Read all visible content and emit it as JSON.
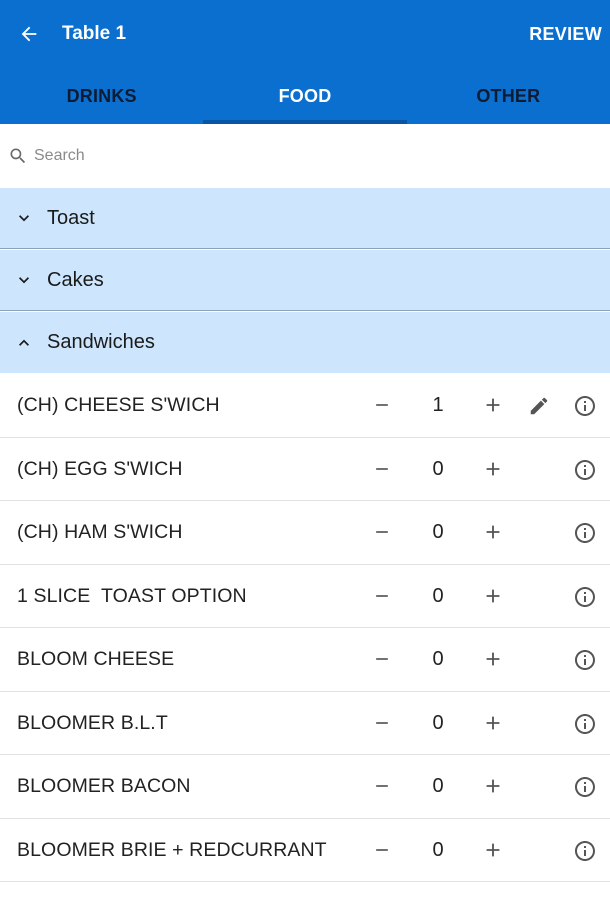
{
  "header": {
    "title": "Table 1",
    "review_label": "REVIEW",
    "back_icon": "arrow-left-icon",
    "background_color": "#0a6fcf"
  },
  "tabs": [
    {
      "label": "DRINKS",
      "active": false
    },
    {
      "label": "FOOD",
      "active": true
    },
    {
      "label": "OTHER",
      "active": false
    }
  ],
  "search": {
    "placeholder": "Search",
    "icon": "search-icon"
  },
  "categories": [
    {
      "label": "Toast",
      "expanded": false
    },
    {
      "label": "Cakes",
      "expanded": false
    },
    {
      "label": "Sandwiches",
      "expanded": true
    }
  ],
  "items": [
    {
      "name": "(CH) CHEESE S'WICH",
      "qty": "1",
      "editable": true
    },
    {
      "name": "(CH) EGG S'WICH",
      "qty": "0",
      "editable": false
    },
    {
      "name": "(CH) HAM S'WICH",
      "qty": "0",
      "editable": false
    },
    {
      "name": "1 SLICE  TOAST OPTION",
      "qty": "0",
      "editable": false
    },
    {
      "name": "BLOOM CHEESE",
      "qty": "0",
      "editable": false
    },
    {
      "name": "BLOOMER B.L.T",
      "qty": "0",
      "editable": false
    },
    {
      "name": "BLOOMER BACON",
      "qty": "0",
      "editable": false
    },
    {
      "name": "BLOOMER BRIE + REDCURRANT",
      "qty": "0",
      "editable": false
    }
  ],
  "colors": {
    "primary": "#0a6fcf",
    "category_bg": "#cde6fd",
    "tab_text_inactive": "#0d1b33",
    "icon_gray": "#555555"
  }
}
